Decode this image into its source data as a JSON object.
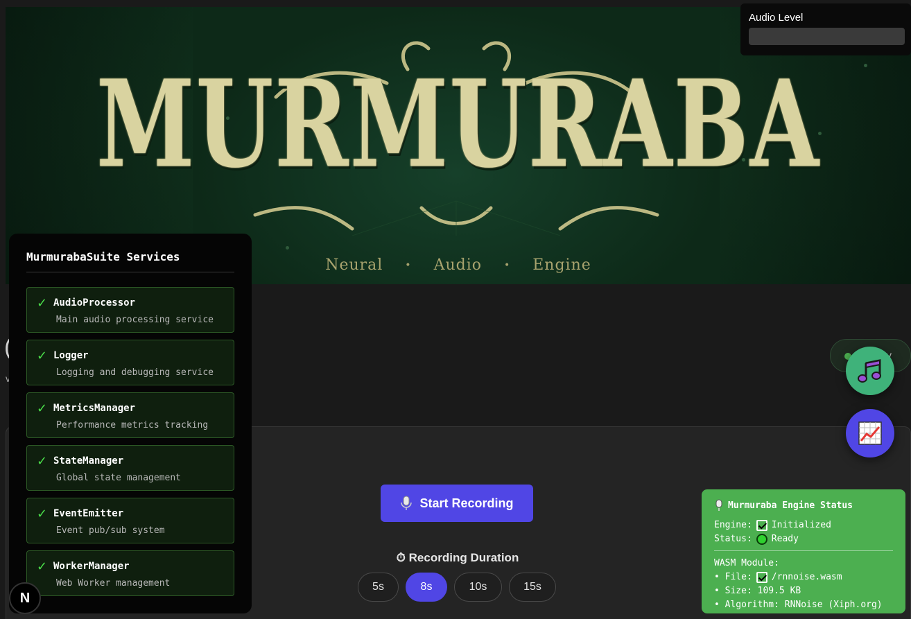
{
  "hero": {
    "logo_text": "MURMURABA",
    "tagline": [
      "Neural",
      "Audio",
      "Engine"
    ],
    "tagline_separator": "•"
  },
  "audio_level": {
    "label": "Audio Level",
    "level": 0
  },
  "background": {
    "left_glyph": "(",
    "left_sub": "v",
    "status_pill_text": "y"
  },
  "recorder": {
    "start_label": "Start Recording",
    "start_icon": "microphone-icon",
    "duration_label": "Recording Duration",
    "duration_icon": "stopwatch-icon",
    "durations": [
      "5s",
      "8s",
      "10s",
      "15s"
    ],
    "selected_duration": "8s"
  },
  "services": {
    "title": "MurmurabaSuite Services",
    "items": [
      {
        "name": "AudioProcessor",
        "desc": "Main audio processing service",
        "check": "✓"
      },
      {
        "name": "Logger",
        "desc": "Logging and debugging service",
        "check": "✓"
      },
      {
        "name": "MetricsManager",
        "desc": "Performance metrics tracking",
        "check": "✓"
      },
      {
        "name": "StateManager",
        "desc": "Global state management",
        "check": "✓"
      },
      {
        "name": "EventEmitter",
        "desc": "Event pub/sub system",
        "check": "✓"
      },
      {
        "name": "WorkerManager",
        "desc": "Web Worker management",
        "check": "✓"
      }
    ]
  },
  "next_badge": "N",
  "engine_status": {
    "title": "Murmuraba Engine Status",
    "engine_label": "Engine:",
    "engine_value": "Initialized",
    "status_label": "Status:",
    "status_value": "Ready",
    "wasm_title": "WASM Module:",
    "file": "• File:",
    "file_value": "/rnnoise.wasm",
    "size": "• Size: 109.5 KB",
    "algorithm": "• Algorithm: RNNoise (Xiph.org)"
  },
  "fabs": {
    "music_icon": "music-note-icon",
    "chart_icon": "chart-icon"
  },
  "colors": {
    "accent": "#5046e5",
    "success": "#4caf50",
    "hero_bg": "#0e2a19",
    "logo": "#d9d3a0"
  }
}
